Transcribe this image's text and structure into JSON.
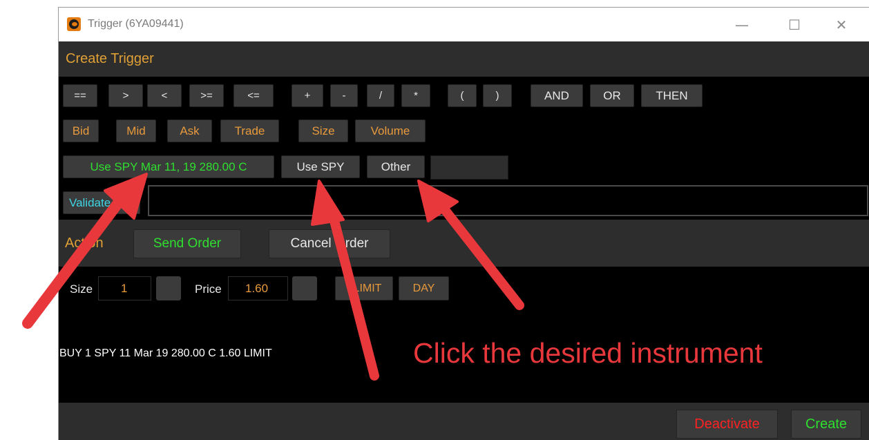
{
  "window": {
    "title": "Trigger (6YA09441)",
    "controls": {
      "minimize": "—",
      "maximize": "☐",
      "close": "✕"
    }
  },
  "create_trigger": {
    "title": "Create Trigger",
    "operators": [
      "==",
      ">",
      "<",
      ">=",
      "<=",
      "+",
      "-",
      "/",
      "*",
      "(",
      ")",
      "AND",
      "OR",
      "THEN"
    ],
    "fields": [
      "Bid",
      "Mid",
      "Ask",
      "Trade",
      "Size",
      "Volume"
    ],
    "instrument_buttons": {
      "use_option": "Use SPY  Mar 11, 19  280.00 C",
      "use_underlying": "Use SPY",
      "other": "Other"
    },
    "validate_label": "Validate",
    "formula_value": ""
  },
  "action": {
    "label": "Action",
    "send_order": "Send Order",
    "cancel_order": "Cancel Order",
    "size_label": "Size",
    "size_value": "1",
    "price_label": "Price",
    "price_value": "1.60",
    "order_type": "LIMIT",
    "tif": "DAY"
  },
  "order_summary": "BUY 1 SPY   11 Mar 19  280.00 C 1.60 LIMIT",
  "footer": {
    "deactivate": "Deactivate",
    "create": "Create"
  },
  "annotation": {
    "text": "Click the desired instrument",
    "color": "#e8383c"
  },
  "colors": {
    "accent_orange": "#e1a035",
    "green": "#2fdf2f",
    "cyan": "#3fd6e4",
    "red": "#ff2222"
  }
}
